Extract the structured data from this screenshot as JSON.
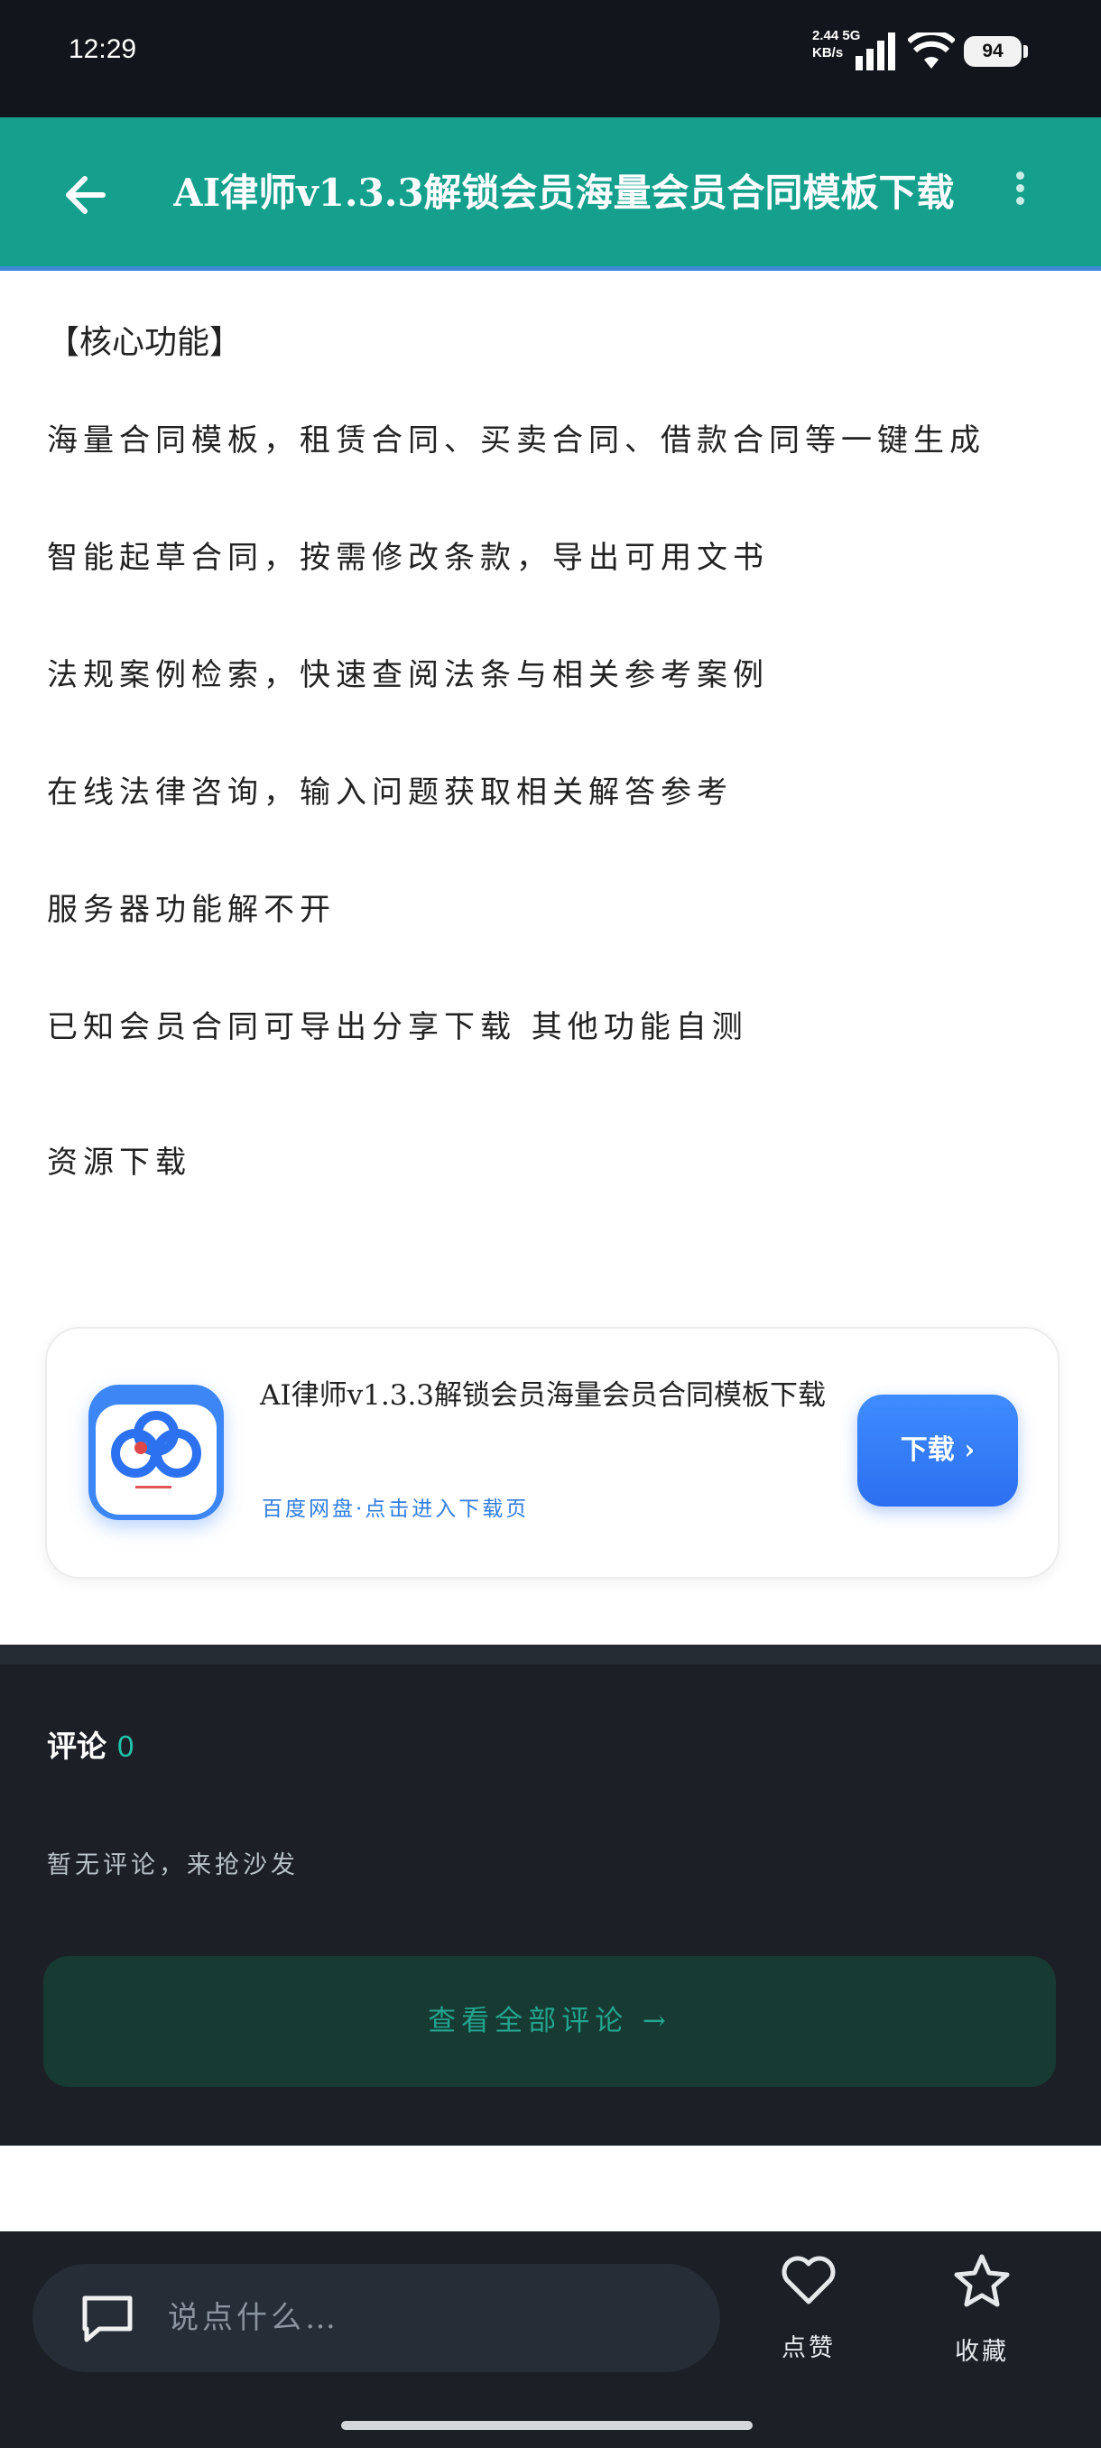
{
  "status_bar": {
    "time": "12:29",
    "net_speed": "2.44",
    "net_unit": "KB/s",
    "network_type": "5G",
    "battery": "94"
  },
  "app_bar": {
    "title": "AI律师v1.3.3解锁会员海量会员合同模板下载",
    "back_icon": "arrow-left-icon",
    "more_icon": "more-vert-icon"
  },
  "content": {
    "heading": "【核心功能】",
    "paragraphs": [
      "海量合同模板，租赁合同、买卖合同、借款合同等一键生成",
      "智能起草合同，按需修改条款，导出可用文书",
      "法规案例检索，快速查阅法条与相关参考案例",
      "在线法律咨询，输入问题获取相关解答参考",
      "服务器功能解不开",
      "已知会员合同可导出分享下载 其他功能自测",
      "资源下载"
    ]
  },
  "resource_card": {
    "title": "AI律师v1.3.3解锁会员海量会员合同模板下载",
    "subtitle": "百度网盘·点击进入下载页",
    "button_label": "下载 ›",
    "icon": "baidu-netdisk-icon"
  },
  "comments": {
    "title": "评论",
    "count": "0",
    "empty_text": "暂无评论，来抢沙发",
    "view_all": "查看全部评论 →"
  },
  "bottom_bar": {
    "input_placeholder": "说点什么…",
    "like_label": "点赞",
    "favorite_label": "收藏"
  },
  "colors": {
    "app_bar": "#14a08c",
    "accent_blue": "#2f7de0",
    "comments_bg": "#1c2026",
    "teal_text": "#22a58f"
  }
}
